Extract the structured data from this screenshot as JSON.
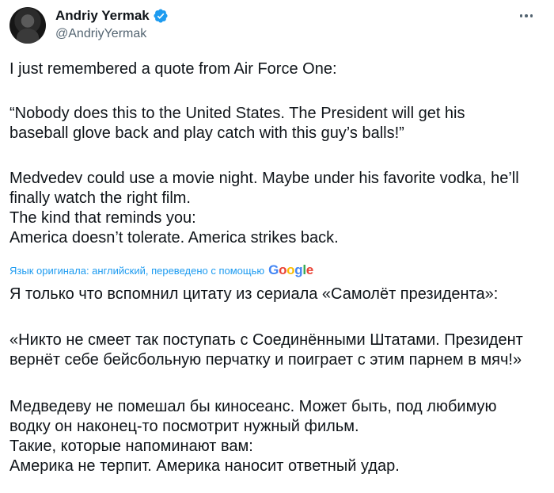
{
  "author": {
    "display_name": "Andriy Yermak",
    "handle": "@AndriyYermak"
  },
  "tweet": {
    "p1": "I just remembered a quote from Air Force One:",
    "p2": "“Nobody does this to the United States. The President will get his\nbaseball glove back and play catch with this guy’s balls!”",
    "p3": "Medvedev could use a movie night. Maybe under his favorite vodka, he’ll\nfinally watch the right film.\nThe kind that reminds you:\nAmerica doesn’t tolerate. America strikes back."
  },
  "translation": {
    "note": "Язык оригинала: английский, переведено с помощью",
    "provider_letters": [
      "G",
      "o",
      "o",
      "g",
      "l",
      "e"
    ],
    "p1": "Я только что вспомнил цитату из сериала «Самолёт президента»:",
    "p2": "«Никто не смеет так поступать с Соединёнными Штатами. Президент\nвернёт себе бейсбольную перчатку и поиграет с этим парнем в мяч!»",
    "p3": "Медведеву не помешал бы киносеанс. Может быть, под любимую\nводку он наконец-то посмотрит нужный фильм.\nТакие, которые напоминают вам:\nАмерика не терпит. Америка наносит ответный удар."
  },
  "colors": {
    "verified": "#1d9bf0",
    "link": "#1d9bf0",
    "muted": "#536471"
  },
  "icons": {
    "verified": "verified-badge-icon",
    "more": "more-options-icon"
  }
}
